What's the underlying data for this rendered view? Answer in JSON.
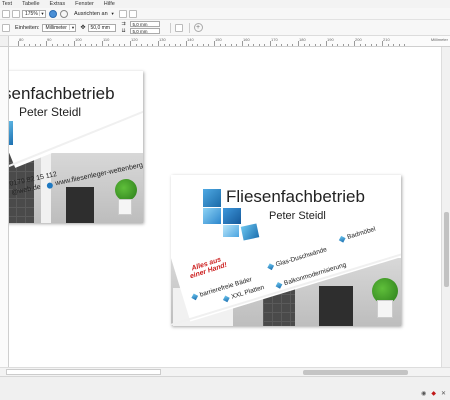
{
  "menubar": {
    "items": [
      "Text",
      "Tabelle",
      "Extras",
      "Fenster",
      "Hilfe"
    ]
  },
  "toolbar": {
    "zoom": "175%",
    "align_label": "Ausrichten an"
  },
  "propertybar": {
    "units_label": "Einheiten:",
    "units_value": "Millimeter",
    "nudge_value": "50,0 mm",
    "dup_x": "5,0 mm",
    "dup_y": "5,0 mm"
  },
  "ruler": {
    "ticks": [
      "80",
      "90",
      "100",
      "110",
      "120",
      "130",
      "140",
      "150",
      "160",
      "170",
      "180",
      "190",
      "200",
      "210"
    ],
    "unit": "Millimeter"
  },
  "card_left": {
    "title": "senfachbetrieb",
    "name": "Peter Steidl",
    "phone": "0179 82 15 112",
    "email": "@web.de",
    "web": "www.fliesenleger-wettenberg.de"
  },
  "card_right": {
    "title": "Fliesenfachbetrieb",
    "name": "Peter Steidl",
    "slogan_line1": "Alles aus",
    "slogan_line2": "einer Hand!",
    "services": [
      "Badmöbel",
      "Glas-Duschwände",
      "Balkonmodernisierung",
      "barrierefreie Bäder",
      "XXL Platten"
    ]
  },
  "colors": {
    "accent_blue": "#1d78c1",
    "tile_blue": "#2a8ed8",
    "slogan_red": "#cc1f1f"
  },
  "icons": [
    "undo-icon",
    "redo-icon",
    "zoom-in-icon",
    "snap-icon",
    "add-page-icon",
    "status-icon"
  ]
}
